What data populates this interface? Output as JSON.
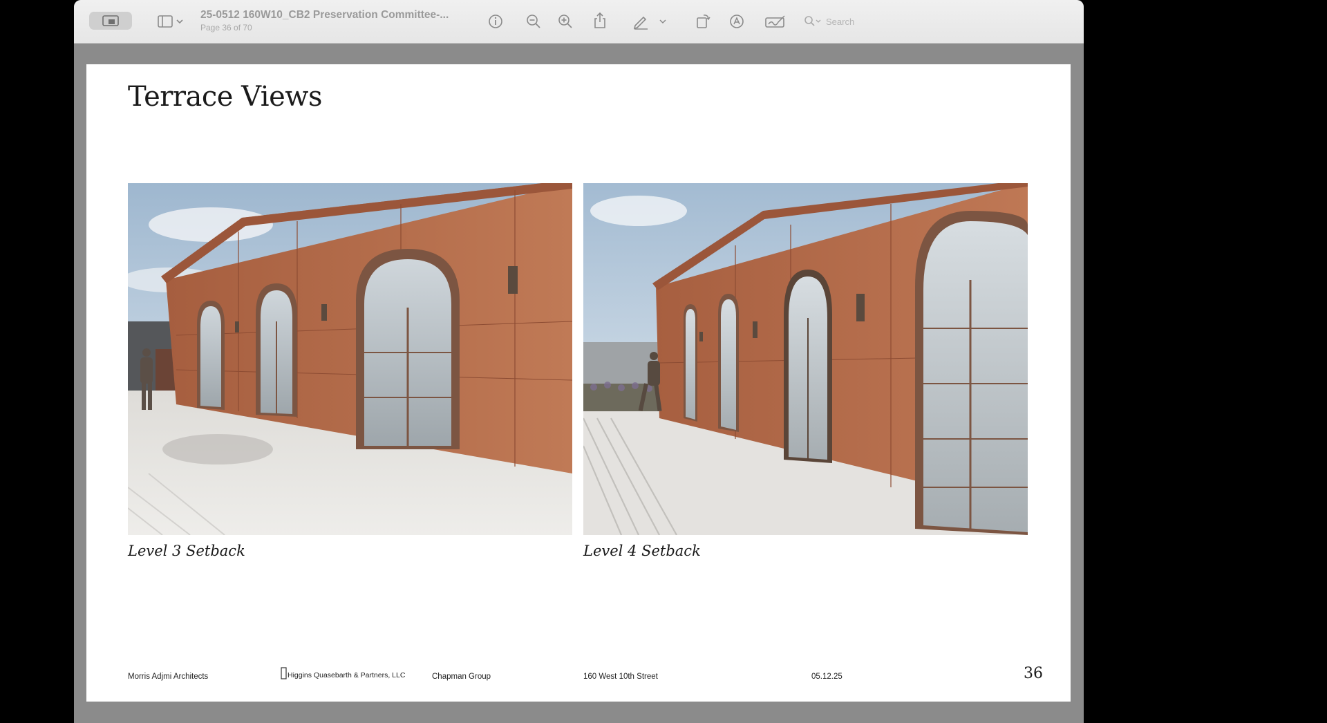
{
  "toolbar": {
    "doc_title": "25-0512 160W10_CB2 Preservation Committee-...",
    "page_indicator": "Page 36 of 70",
    "search_placeholder": "Search",
    "icons": [
      "sidebar-icon",
      "info-icon",
      "zoom-out-icon",
      "zoom-in-icon",
      "share-icon",
      "markup-pen-icon",
      "rotate-icon",
      "annotate-icon",
      "signature-icon",
      "search-icon"
    ]
  },
  "slide": {
    "title": "Terrace Views",
    "images": [
      {
        "caption": "Level 3 Setback"
      },
      {
        "caption": "Level 4 Setback"
      }
    ],
    "footer": {
      "architect": "Morris Adjmi Architects",
      "partner": "Higgins Quasebarth & Partners, LLC",
      "group": "Chapman Group",
      "address": "160 West 10th Street",
      "date": "05.12.25",
      "page_number": "36"
    }
  },
  "colors": {
    "terracotta": "#b8704f",
    "window_bg": "#8b8b8b",
    "toolbar_bg": "#ececec"
  }
}
